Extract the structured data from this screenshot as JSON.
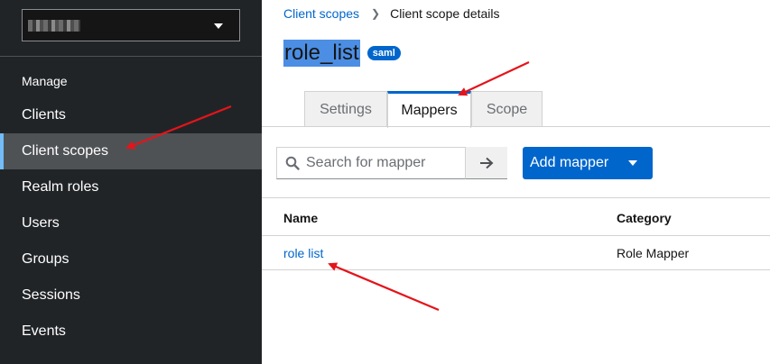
{
  "sidebar": {
    "section": "Manage",
    "items": [
      {
        "label": "Clients",
        "active": false
      },
      {
        "label": "Client scopes",
        "active": true
      },
      {
        "label": "Realm roles",
        "active": false
      },
      {
        "label": "Users",
        "active": false
      },
      {
        "label": "Groups",
        "active": false
      },
      {
        "label": "Sessions",
        "active": false
      },
      {
        "label": "Events",
        "active": false
      }
    ]
  },
  "breadcrumb": {
    "parent": "Client scopes",
    "current": "Client scope details"
  },
  "page": {
    "title": "role_list",
    "badge": "saml"
  },
  "tabs": [
    {
      "label": "Settings",
      "active": false
    },
    {
      "label": "Mappers",
      "active": true
    },
    {
      "label": "Scope",
      "active": false
    }
  ],
  "toolbar": {
    "search_placeholder": "Search for mapper",
    "add_label": "Add mapper"
  },
  "table": {
    "headers": [
      "Name",
      "Category"
    ],
    "rows": [
      {
        "name": "role list",
        "category": "Role Mapper"
      }
    ]
  },
  "colors": {
    "sidebar_bg": "#212427",
    "accent": "#0066cc",
    "highlight": "#4b8ee3",
    "annotation": "#e4141b"
  },
  "icons": {
    "realm_caret": "caret-down-icon",
    "search": "search-icon",
    "go": "arrow-right-icon",
    "add_caret": "caret-down-icon"
  }
}
